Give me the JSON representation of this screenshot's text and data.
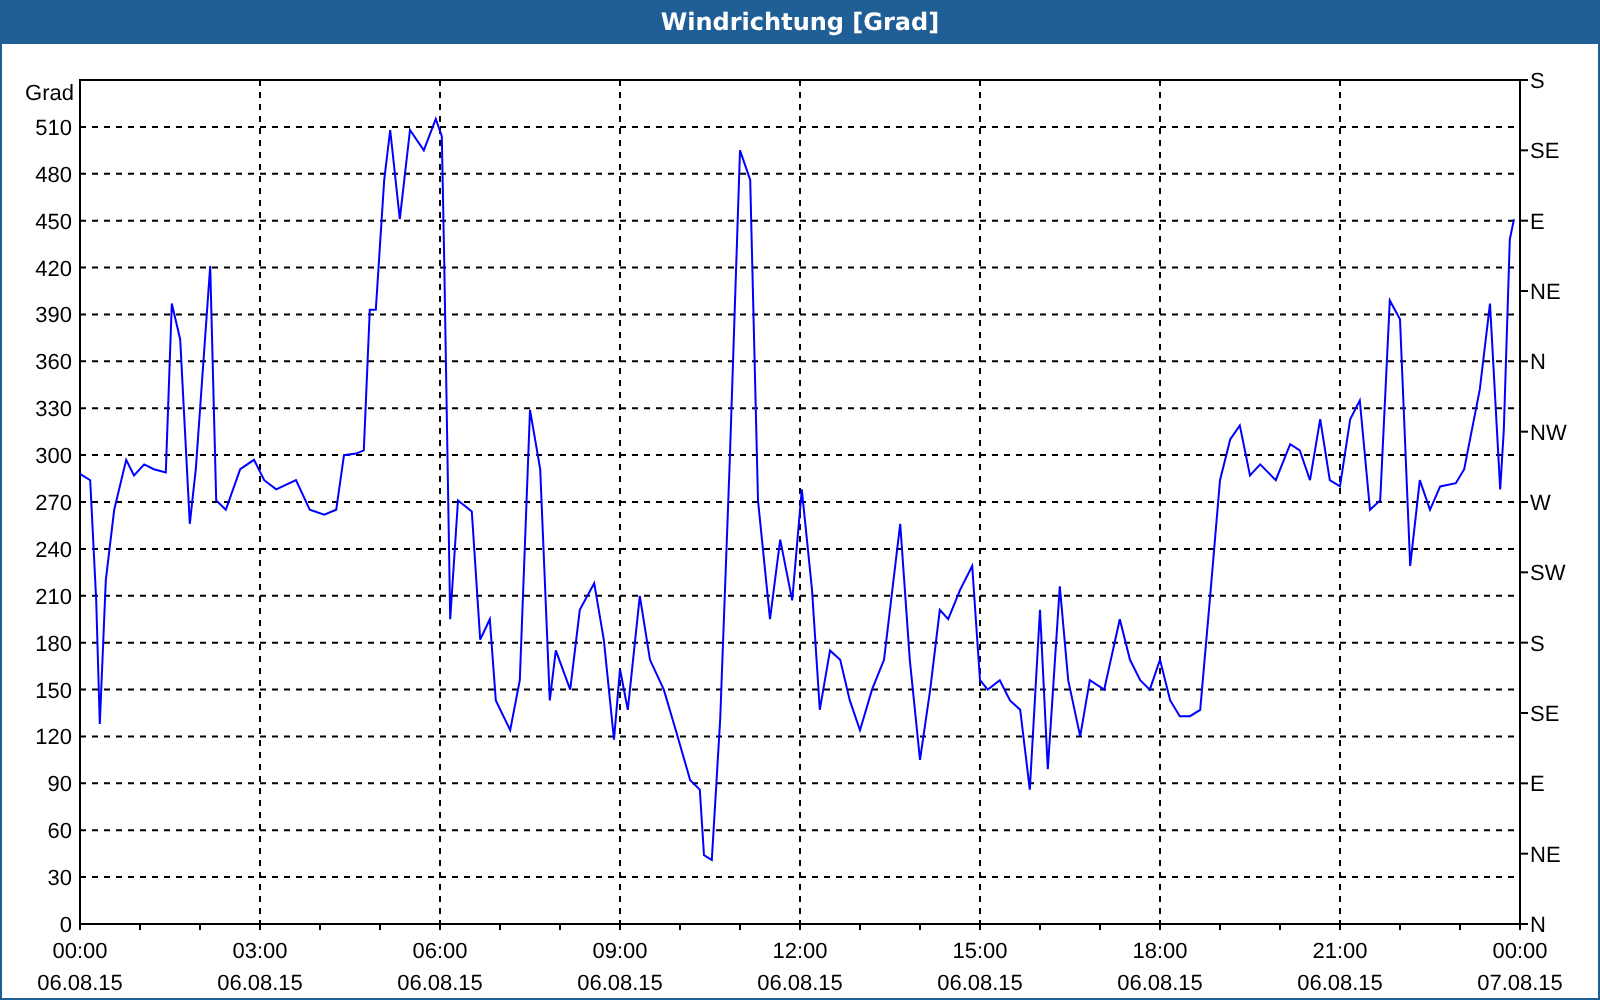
{
  "window": {
    "title": "Windrichtung [Grad]"
  },
  "chart": {
    "chart_data": {
      "type": "line",
      "grid": true,
      "ylabel": "Grad",
      "xlim": [
        0,
        24
      ],
      "ylim": [
        0,
        540
      ],
      "yticks": [
        0,
        30,
        60,
        90,
        120,
        150,
        180,
        210,
        240,
        270,
        300,
        330,
        360,
        390,
        420,
        450,
        480,
        510
      ],
      "xticks": [
        {
          "value": 0,
          "label": "00:00"
        },
        {
          "value": 3,
          "label": "03:00"
        },
        {
          "value": 6,
          "label": "06:00"
        },
        {
          "value": 9,
          "label": "09:00"
        },
        {
          "value": 12,
          "label": "12:00"
        },
        {
          "value": 15,
          "label": "15:00"
        },
        {
          "value": 18,
          "label": "18:00"
        },
        {
          "value": 21,
          "label": "21:00"
        },
        {
          "value": 24,
          "label": "00:00"
        }
      ],
      "x": [
        0,
        0.17,
        0.27,
        0.33,
        0.43,
        0.57,
        0.77,
        0.9,
        1.07,
        1.23,
        1.43,
        1.53,
        1.67,
        1.83,
        1.93,
        2.17,
        2.27,
        2.43,
        2.67,
        2.9,
        3.07,
        3.27,
        3.6,
        3.83,
        4.07,
        4.27,
        4.4,
        4.6,
        4.73,
        4.83,
        4.93,
        5.07,
        5.17,
        5.33,
        5.5,
        5.73,
        5.93,
        6.03,
        6.07,
        6.17,
        6.3,
        6.53,
        6.67,
        6.83,
        6.93,
        7.17,
        7.33,
        7.5,
        7.67,
        7.83,
        7.93,
        8.17,
        8.33,
        8.57,
        8.73,
        8.9,
        9,
        9.13,
        9.33,
        9.5,
        9.73,
        9.93,
        10.17,
        10.33,
        10.4,
        10.53,
        10.67,
        10.83,
        11,
        11.17,
        11.3,
        11.5,
        11.67,
        11.87,
        12.03,
        12.2,
        12.33,
        12.5,
        12.67,
        12.83,
        13,
        13.2,
        13.4,
        13.67,
        13.83,
        14,
        14.17,
        14.33,
        14.47,
        14.67,
        14.87,
        15,
        15.13,
        15.33,
        15.5,
        15.67,
        15.83,
        16,
        16.13,
        16.33,
        16.47,
        16.67,
        16.83,
        17.07,
        17.33,
        17.5,
        17.67,
        17.83,
        18,
        18.17,
        18.33,
        18.5,
        18.67,
        18.83,
        19,
        19.17,
        19.33,
        19.5,
        19.67,
        19.93,
        20.17,
        20.33,
        20.5,
        20.67,
        20.83,
        21,
        21.17,
        21.33,
        21.5,
        21.67,
        21.83,
        22,
        22.17,
        22.33,
        22.5,
        22.67,
        22.93,
        23.07,
        23.33,
        23.5,
        23.67,
        23.73,
        23.83,
        23.9
      ],
      "series": [
        {
          "color": "#0000ff",
          "values": [
            288,
            284,
            207,
            128,
            220,
            265,
            297,
            287,
            294,
            291,
            289,
            397,
            374,
            256,
            291,
            421,
            271,
            265,
            291,
            297,
            284,
            278,
            284,
            265,
            262,
            265,
            300,
            301,
            303,
            393,
            393,
            476,
            508,
            451,
            508,
            495,
            515,
            504,
            425,
            195,
            271,
            264,
            182,
            195,
            143,
            124,
            156,
            329,
            291,
            143,
            175,
            150,
            201,
            218,
            182,
            118,
            163,
            137,
            210,
            169,
            150,
            124,
            92,
            86,
            44,
            41,
            131,
            297,
            495,
            476,
            271,
            195,
            246,
            207,
            278,
            214,
            137,
            175,
            169,
            143,
            124,
            150,
            169,
            256,
            169,
            105,
            150,
            201,
            195,
            214,
            229,
            156,
            150,
            156,
            143,
            137,
            86,
            201,
            99,
            216,
            156,
            120,
            156,
            150,
            195,
            169,
            156,
            150,
            169,
            143,
            133,
            133,
            137,
            207,
            284,
            310,
            319,
            287,
            294,
            284,
            307,
            303,
            284,
            323,
            284,
            280,
            323,
            335,
            265,
            271,
            399,
            387,
            229,
            284,
            265,
            280,
            282,
            291,
            342,
            397,
            278,
            316,
            438,
            451
          ]
        }
      ]
    },
    "xtick_dates": [
      "06.08.15",
      "06.08.15",
      "06.08.15",
      "06.08.15",
      "06.08.15",
      "06.08.15",
      "06.08.15",
      "06.08.15",
      "07.08.15"
    ],
    "compass_labels": [
      "S",
      "SE",
      "E",
      "NE",
      "N",
      "NW",
      "W",
      "SW",
      "S",
      "SE",
      "E",
      "NE",
      "N"
    ]
  }
}
